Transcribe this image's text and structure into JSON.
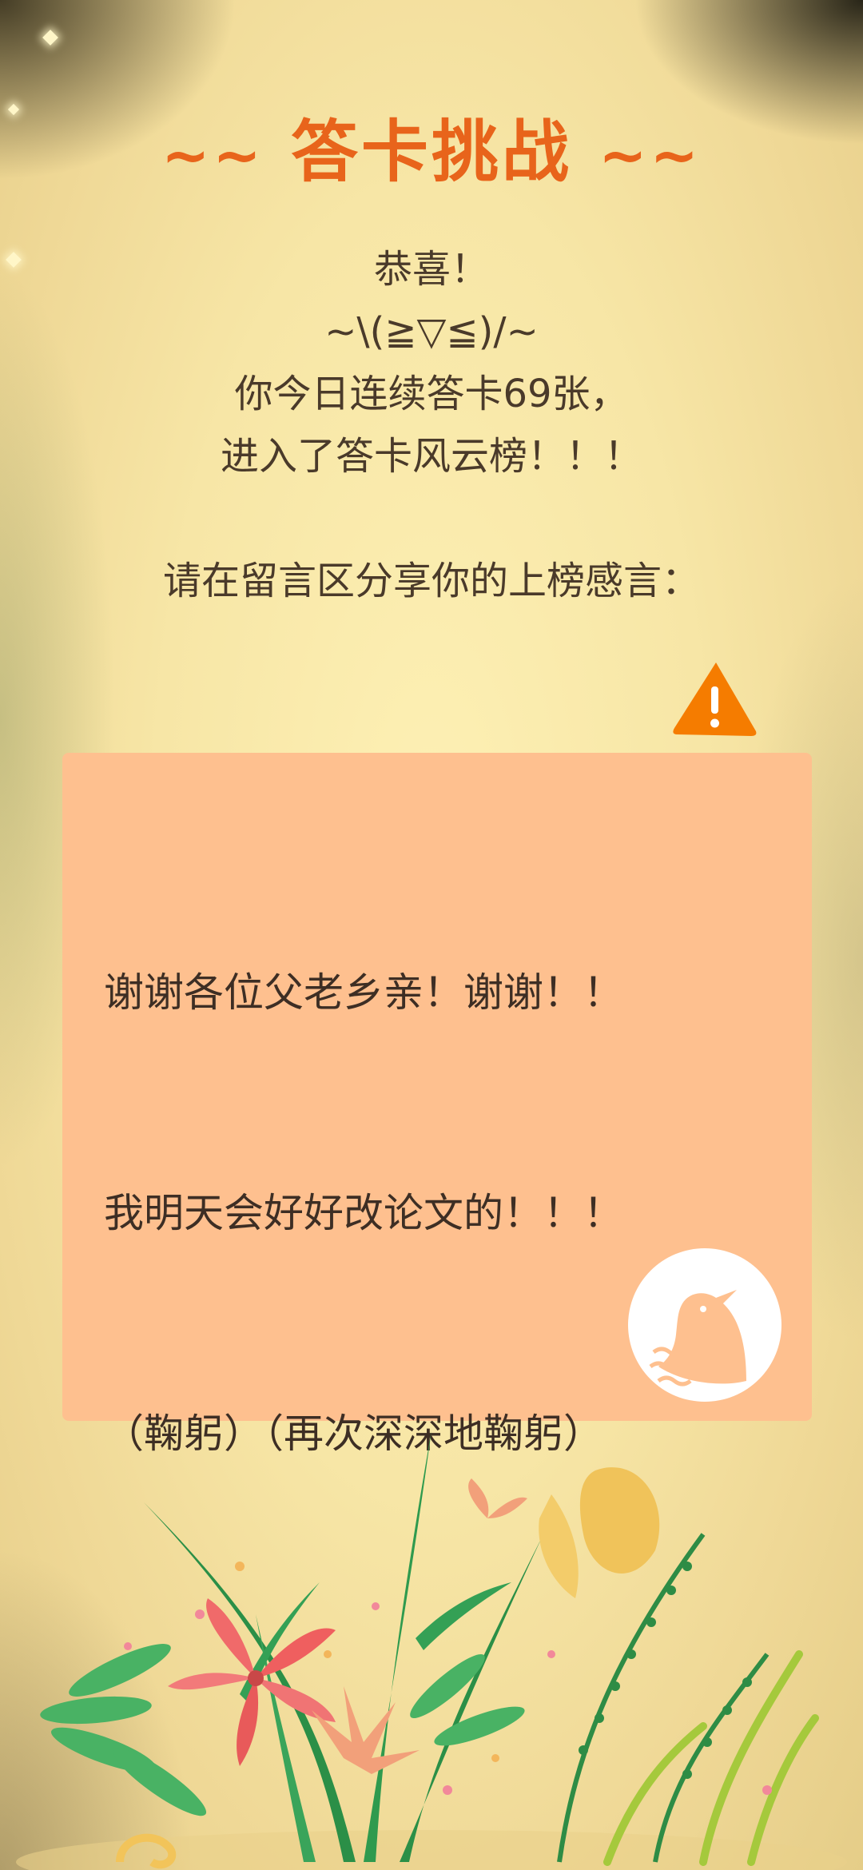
{
  "challenge": {
    "title_prefix": "~~",
    "title": "答卡挑战",
    "title_suffix": "~~",
    "congrats_lines": [
      "恭喜！",
      "~\\(≧▽≦)/~",
      "你今日连续答卡69张，",
      "进入了答卡风云榜！！！"
    ],
    "prompt": "请在留言区分享你的上榜感言："
  },
  "comment_card": {
    "lines": [
      "谢谢各位父老乡亲！谢谢！！",
      "我明天会好好改论文的！！！",
      "（鞠躬）（再次深深地鞠躬）"
    ],
    "avatar_icon": "bird-avatar-icon",
    "warning_icon": "warning-icon"
  },
  "colors": {
    "title": "#e8641b",
    "card": "#fec08f",
    "warning": "#f57c00",
    "background": "#f7e6a6"
  }
}
